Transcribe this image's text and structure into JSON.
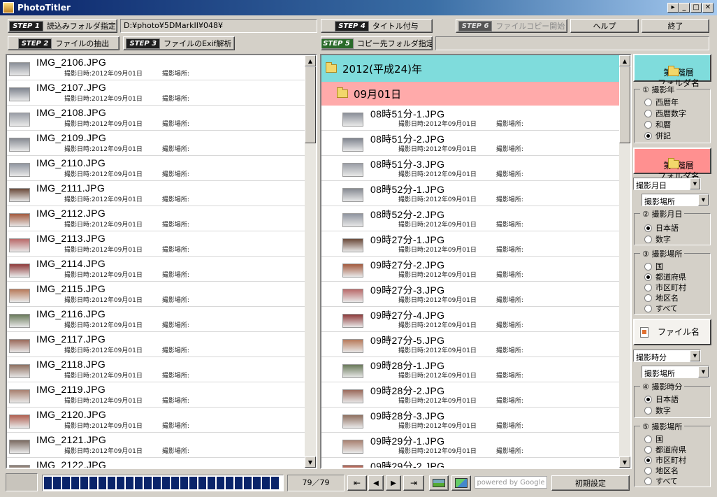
{
  "window": {
    "title": "PhotoTitler"
  },
  "toolbar": {
    "step1_tag": "STEP 1",
    "step1_label": "読込みフォルダ指定",
    "source_path": "D:¥photo¥5DMarkII¥048¥",
    "step2_tag": "STEP 2",
    "step2_label": "ファイルの抽出",
    "step3_tag": "STEP 3",
    "step3_label": "ファイルのExif解析",
    "step4_tag": "STEP 4",
    "step4_label": "タイトル付与",
    "step5_tag": "STEP 5",
    "step5_label": "コピー先フォルダ指定",
    "dest_path": "",
    "step6_tag": "STEP 6",
    "step6_label": "ファイルコピー開始",
    "help_label": "ヘルプ",
    "exit_label": "終了"
  },
  "meta_labels": {
    "date": "撮影日時:2012年09月01日",
    "place": "撮影場所:"
  },
  "source_files": [
    "IMG_2106.JPG",
    "IMG_2107.JPG",
    "IMG_2108.JPG",
    "IMG_2109.JPG",
    "IMG_2110.JPG",
    "IMG_2111.JPG",
    "IMG_2112.JPG",
    "IMG_2113.JPG",
    "IMG_2114.JPG",
    "IMG_2115.JPG",
    "IMG_2116.JPG",
    "IMG_2117.JPG",
    "IMG_2118.JPG",
    "IMG_2119.JPG",
    "IMG_2120.JPG",
    "IMG_2121.JPG",
    "IMG_2122.JPG"
  ],
  "result": {
    "year_folder": "2012(平成24)年",
    "day_folder": "09月01日",
    "files": [
      "08時51分-1.JPG",
      "08時51分-2.JPG",
      "08時51分-3.JPG",
      "08時52分-1.JPG",
      "08時52分-2.JPG",
      "09時27分-1.JPG",
      "09時27分-2.JPG",
      "09時27分-3.JPG",
      "09時27分-4.JPG",
      "09時27分-5.JPG",
      "09時28分-1.JPG",
      "09時28分-2.JPG",
      "09時28分-3.JPG",
      "09時29分-1.JPG",
      "09時29分-2.JPG"
    ]
  },
  "options": {
    "level1_btn": "第1階層\nフォルダ名",
    "year_group": {
      "title": "① 撮影年",
      "options": [
        "西暦年",
        "西暦数字",
        "和暦",
        "併記"
      ],
      "selected": 3
    },
    "level2_btn": "第2階層\nフォルダ名",
    "level2_select1": "撮影月日",
    "level2_select2": "撮影場所",
    "monthday_group": {
      "title": "② 撮影月日",
      "options": [
        "日本語",
        "数字"
      ],
      "selected": 0
    },
    "place_group": {
      "title": "③ 撮影場所",
      "options": [
        "国",
        "都道府県",
        "市区町村",
        "地区名",
        "すべて"
      ],
      "selected": 1
    },
    "filename_btn": "ファイル名",
    "file_select1": "撮影時分",
    "file_select2": "撮影場所",
    "time_group": {
      "title": "④ 撮影時分",
      "options": [
        "日本語",
        "数字"
      ],
      "selected": 0
    },
    "place2_group": {
      "title": "⑤ 撮影場所",
      "options": [
        "国",
        "都道府県",
        "市区町村",
        "地区名",
        "すべて"
      ],
      "selected": 2
    }
  },
  "status": {
    "progress_percent": 100,
    "count": "79／79",
    "google": "powered by Google",
    "reset_label": "初期設定"
  },
  "colors": {
    "year_folder_bg": "#7fdcdc",
    "day_folder_bg": "#ffaaaa",
    "level1_btn": "#7fdcdc",
    "level2_btn": "#ff9090"
  }
}
